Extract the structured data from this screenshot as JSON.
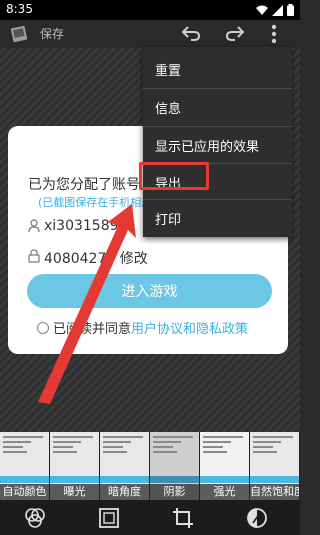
{
  "status_bar": {
    "time": "8:35"
  },
  "app_bar": {
    "title": "保存"
  },
  "dialog": {
    "title": "已为您分配了账号",
    "subtitle": "(已截图保存在手机相册)",
    "account": "xi3031589",
    "password": "40804277",
    "password_action": "修改",
    "enter_button": "进入游戏",
    "agree_prefix": "已阅读并同意",
    "agree_link": "用户协议和隐私政策"
  },
  "menu": {
    "items": [
      {
        "label": "重置"
      },
      {
        "label": "信息"
      },
      {
        "label": "显示已应用的效果"
      },
      {
        "label": "导出"
      },
      {
        "label": "打印"
      }
    ],
    "highlight_color": "#e53935"
  },
  "effects": [
    {
      "label": "自动颜色"
    },
    {
      "label": "曝光"
    },
    {
      "label": "暗角度"
    },
    {
      "label": "阴影"
    },
    {
      "label": "强光"
    },
    {
      "label": "自然饱和度"
    }
  ],
  "toolbar": {
    "icons": [
      "filters-icon",
      "frame-icon",
      "crop-icon",
      "adjust-icon"
    ]
  },
  "colors": {
    "accent": "#6bc7e3",
    "link": "#3ab0e0",
    "arrow": "#e53935"
  }
}
